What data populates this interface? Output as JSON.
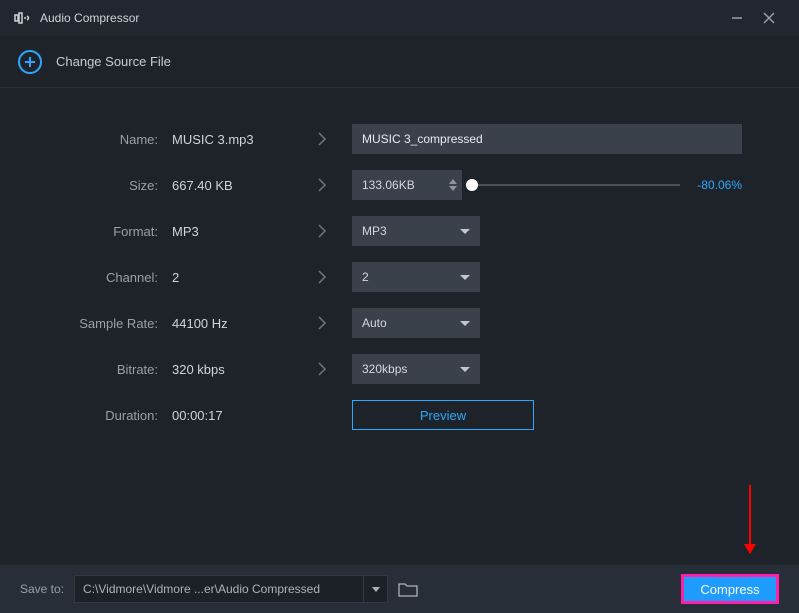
{
  "titlebar": {
    "title": "Audio Compressor"
  },
  "source": {
    "label": "Change Source File"
  },
  "rows": {
    "name": {
      "label": "Name:",
      "current": "MUSIC 3.mp3",
      "new": "MUSIC 3_compressed"
    },
    "size": {
      "label": "Size:",
      "current": "667.40 KB",
      "new": "133.06KB",
      "percent": "-80.06%"
    },
    "format": {
      "label": "Format:",
      "current": "MP3",
      "new": "MP3"
    },
    "channel": {
      "label": "Channel:",
      "current": "2",
      "new": "2"
    },
    "samplerate": {
      "label": "Sample Rate:",
      "current": "44100 Hz",
      "new": "Auto"
    },
    "bitrate": {
      "label": "Bitrate:",
      "current": "320 kbps",
      "new": "320kbps"
    },
    "duration": {
      "label": "Duration:",
      "current": "00:00:17",
      "preview": "Preview"
    }
  },
  "footer": {
    "saveto_label": "Save to:",
    "path": "C:\\Vidmore\\Vidmore ...er\\Audio Compressed",
    "compress": "Compress"
  }
}
